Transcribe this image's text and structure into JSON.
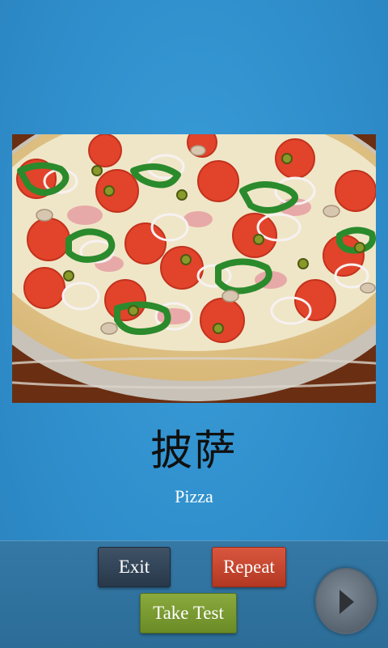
{
  "flashcard": {
    "word": "披萨",
    "translation": "Pizza",
    "image_icon": "pizza-photo"
  },
  "controls": {
    "exit_label": "Exit",
    "repeat_label": "Repeat",
    "take_test_label": "Take Test",
    "next_icon": "play-icon"
  },
  "colors": {
    "background": "#2f8fcc",
    "bottom_bar": "#2f72a0",
    "exit_button": "#33465a",
    "repeat_button": "#c8472f",
    "take_test_button": "#7a9a30",
    "next_button": "#6b7783"
  }
}
